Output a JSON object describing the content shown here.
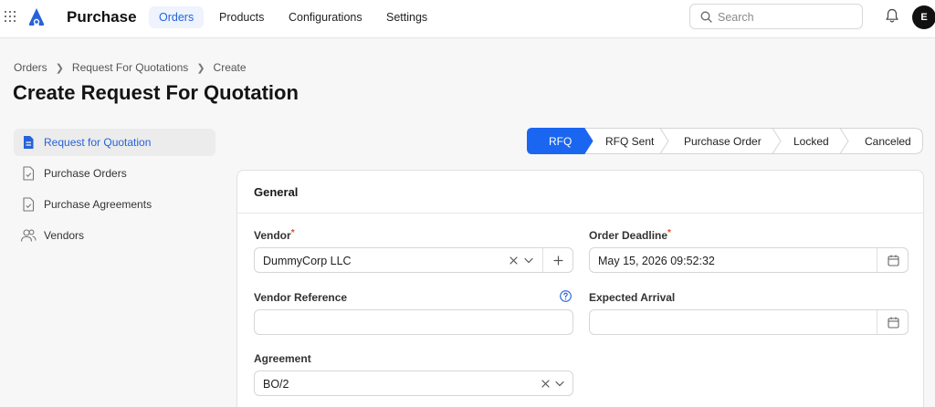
{
  "app": {
    "title": "Purchase",
    "avatar_initial": "E"
  },
  "nav": {
    "tabs": [
      {
        "label": "Orders",
        "active": true
      },
      {
        "label": "Products",
        "active": false
      },
      {
        "label": "Configurations",
        "active": false
      },
      {
        "label": "Settings",
        "active": false
      }
    ]
  },
  "search": {
    "placeholder": "Search",
    "value": ""
  },
  "breadcrumb": [
    "Orders",
    "Request For Quotations",
    "Create"
  ],
  "page_title": "Create Request For Quotation",
  "sidebar": {
    "items": [
      {
        "label": "Request for Quotation",
        "icon": "document-icon",
        "active": true
      },
      {
        "label": "Purchase Orders",
        "icon": "document-check-icon",
        "active": false
      },
      {
        "label": "Purchase Agreements",
        "icon": "document-check-icon",
        "active": false
      },
      {
        "label": "Vendors",
        "icon": "users-icon",
        "active": false
      }
    ]
  },
  "status_steps": [
    {
      "label": "RFQ",
      "active": true
    },
    {
      "label": "RFQ Sent",
      "active": false
    },
    {
      "label": "Purchase Order",
      "active": false
    },
    {
      "label": "Locked",
      "active": false
    },
    {
      "label": "Canceled",
      "active": false
    }
  ],
  "form": {
    "section_title": "General",
    "vendor": {
      "label": "Vendor",
      "required": "*",
      "value": "DummyCorp LLC"
    },
    "order_deadline": {
      "label": "Order Deadline",
      "required": "*",
      "value": "May 15, 2026 09:52:32"
    },
    "vendor_reference": {
      "label": "Vendor Reference",
      "value": ""
    },
    "expected_arrival": {
      "label": "Expected Arrival",
      "value": ""
    },
    "agreement": {
      "label": "Agreement",
      "value": "BO/2"
    }
  },
  "colors": {
    "accent": "#2563d9",
    "active_step": "#1a66f0",
    "nav_active_bg": "#eef3fd"
  }
}
